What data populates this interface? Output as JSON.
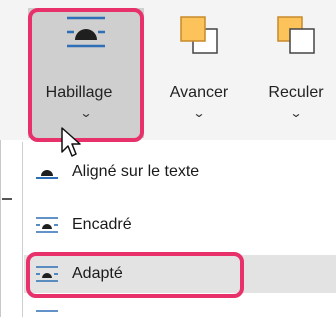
{
  "ribbon": {
    "buttons": [
      {
        "id": "wrap",
        "label": "Habillage",
        "icon": "wrap-text-icon"
      },
      {
        "id": "forward",
        "label": "Avancer",
        "icon": "bring-forward-icon"
      },
      {
        "id": "back",
        "label": "Reculer",
        "icon": "send-backward-icon"
      }
    ],
    "chevron": "⌄"
  },
  "menu": {
    "items": [
      {
        "label": "Aligné sur le texte",
        "icon": "inline-with-text-icon"
      },
      {
        "label": "Encadré",
        "icon": "square-wrap-icon"
      },
      {
        "label": "Adapté",
        "icon": "tight-wrap-icon",
        "selected": true
      }
    ]
  },
  "colors": {
    "highlight": "#e8306a",
    "icon_blue": "#2e6fb5",
    "folder_fill": "#fbc35a"
  }
}
